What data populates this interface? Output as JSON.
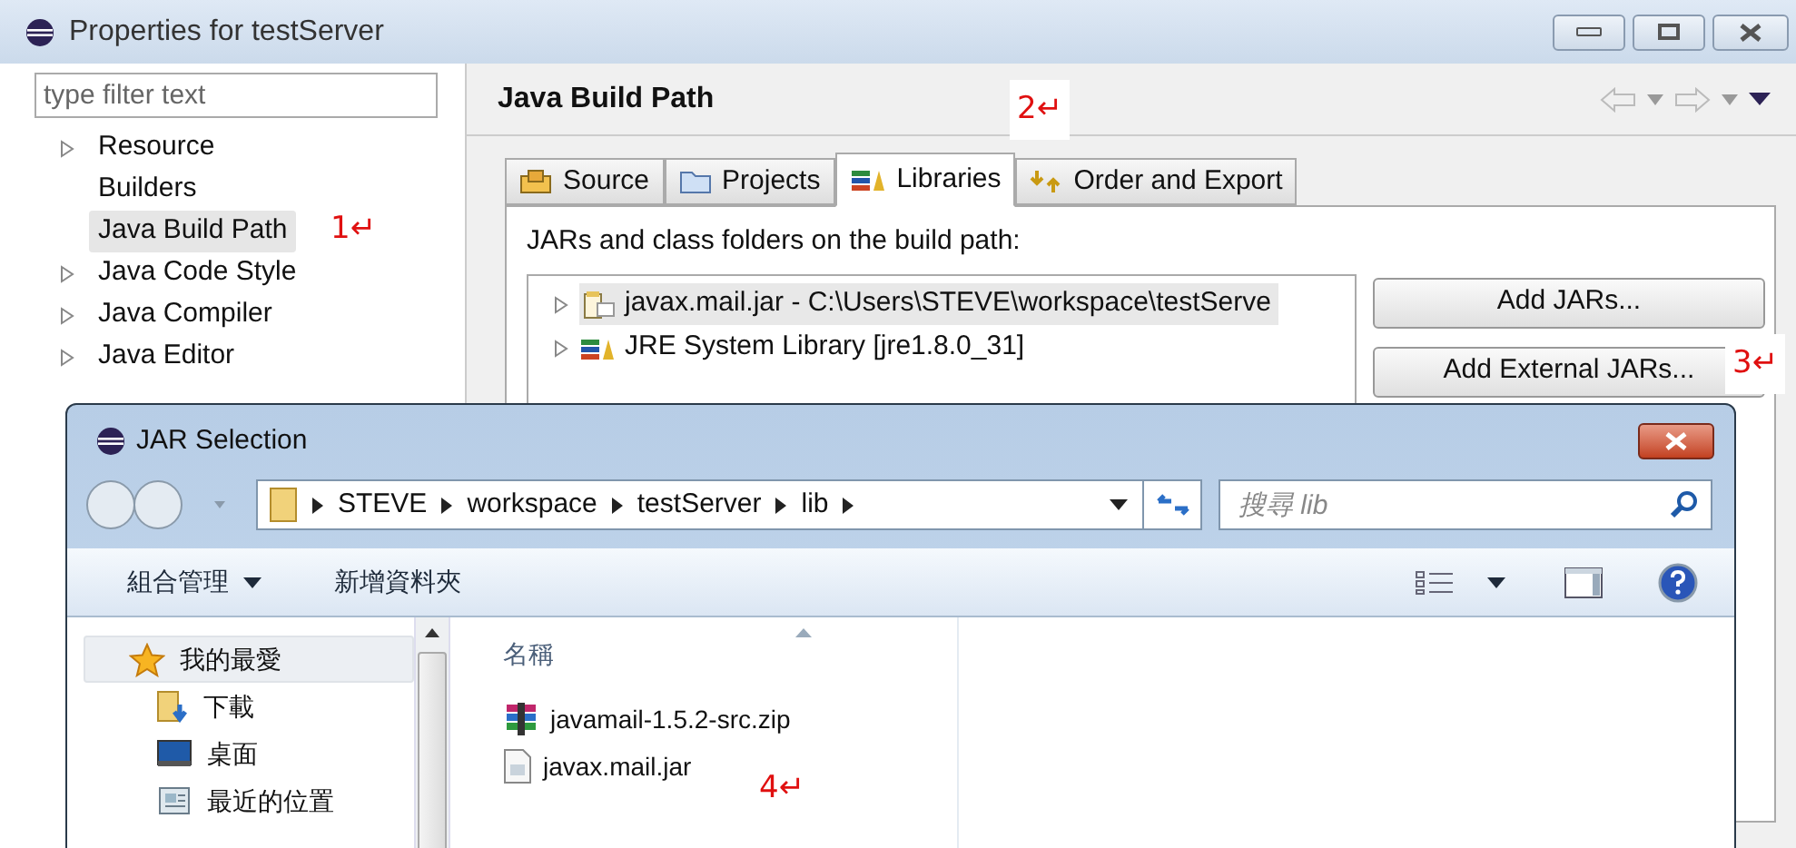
{
  "window": {
    "title": "Properties for testServer"
  },
  "filter": {
    "placeholder": "type filter text"
  },
  "tree": [
    {
      "label": "Resource",
      "expandable": true,
      "selected": false
    },
    {
      "label": "Builders",
      "expandable": false,
      "selected": false
    },
    {
      "label": "Java Build Path",
      "expandable": false,
      "selected": true
    },
    {
      "label": "Java Code Style",
      "expandable": true,
      "selected": false
    },
    {
      "label": "Java Compiler",
      "expandable": true,
      "selected": false
    },
    {
      "label": "Java Editor",
      "expandable": true,
      "selected": false
    }
  ],
  "page_title": "Java Build Path",
  "tabs": [
    {
      "label": "Source",
      "kind": "source",
      "selected": false
    },
    {
      "label": "Projects",
      "kind": "projects",
      "selected": false
    },
    {
      "label": "Libraries",
      "kind": "libraries",
      "selected": true
    },
    {
      "label": "Order and Export",
      "kind": "order",
      "selected": false
    }
  ],
  "libraries_label": "JARs and class folders on the build path:",
  "libraries": [
    {
      "label": "javax.mail.jar - C:\\Users\\STEVE\\workspace\\testServe",
      "kind": "jar",
      "selected": true
    },
    {
      "label": "JRE System Library [jre1.8.0_31]",
      "kind": "jre",
      "selected": false
    }
  ],
  "buttons": [
    "Add JARs...",
    "Add External JARs..."
  ],
  "annotations": [
    {
      "text": "1↵"
    },
    {
      "text": "2↵"
    },
    {
      "text": "3↵"
    },
    {
      "text": "4↵"
    }
  ],
  "dialog": {
    "title": "JAR Selection",
    "breadcrumb": [
      "STEVE",
      "workspace",
      "testServer",
      "lib"
    ],
    "search": {
      "placeholder": "搜尋 lib"
    },
    "toolbar": [
      {
        "label": "組合管理",
        "dropdown": true
      },
      {
        "label": "新增資料夾",
        "dropdown": false
      }
    ],
    "nav": [
      {
        "label": "我的最愛",
        "kind": "favorites",
        "selected": true
      },
      {
        "label": "下載",
        "kind": "downloads",
        "selected": false
      },
      {
        "label": "桌面",
        "kind": "desktop",
        "selected": false
      },
      {
        "label": "最近的位置",
        "kind": "recent",
        "selected": false
      }
    ],
    "column": "名稱",
    "files": [
      {
        "name": "javamail-1.5.2-src.zip",
        "kind": "zip"
      },
      {
        "name": "javax.mail.jar",
        "kind": "jar"
      }
    ]
  }
}
